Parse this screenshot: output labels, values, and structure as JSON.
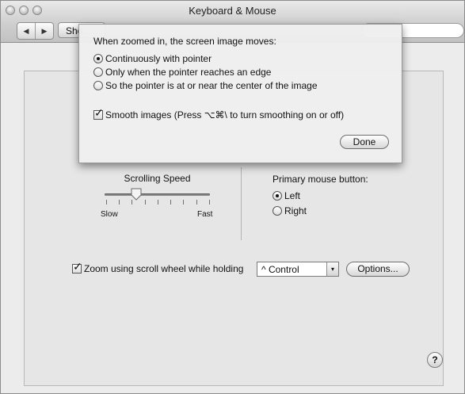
{
  "window": {
    "title": "Keyboard & Mouse"
  },
  "toolbar": {
    "back_glyph": "◀",
    "forward_glyph": "▶",
    "show_all_label": "Sho"
  },
  "mouse": {
    "scrolling_speed_label": "Scrolling Speed",
    "slow_label": "Slow",
    "fast_label": "Fast",
    "scrolling_speed_level": 0.3,
    "primary_button_label": "Primary mouse button:",
    "left_label": "Left",
    "right_label": "Right",
    "primary_selected": "Left"
  },
  "zoom": {
    "checkbox_label": "Zoom using scroll wheel while holding",
    "checked": true,
    "modifier_value": "^ Control",
    "options_label": "Options..."
  },
  "help": {
    "glyph": "?"
  },
  "sheet": {
    "heading": "When zoomed in, the screen image moves:",
    "options": [
      {
        "label": "Continuously with pointer",
        "selected": true
      },
      {
        "label": "Only when the pointer reaches an edge",
        "selected": false
      },
      {
        "label": "So the pointer is at or near the center of the image",
        "selected": false
      }
    ],
    "smooth_label": "Smooth images (Press ⌥⌘\\ to turn smoothing on or off)",
    "smooth_checked": true,
    "done_label": "Done"
  },
  "icons": {
    "check": "✓",
    "dropdown": "▾",
    "help": "question-mark-icon"
  }
}
